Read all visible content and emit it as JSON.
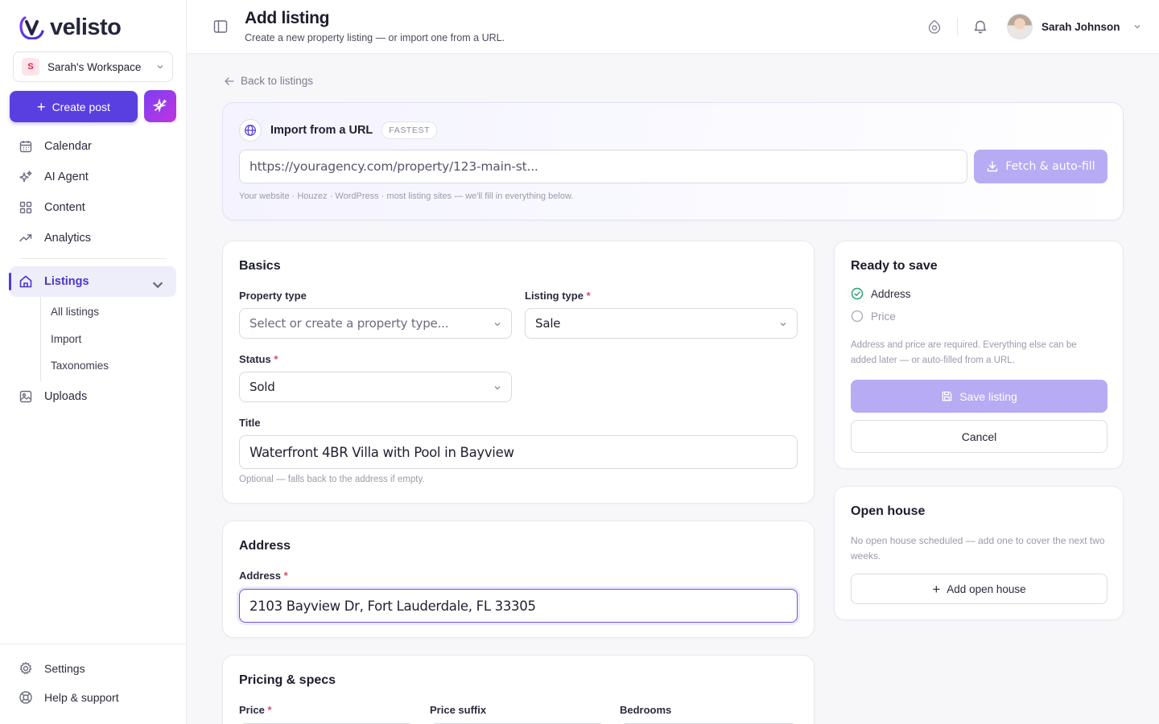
{
  "brand": {
    "name": "velisto"
  },
  "workspace": {
    "initial": "S",
    "name": "Sarah's Workspace"
  },
  "sidebar": {
    "create_post_label": "Create post",
    "items": [
      {
        "label": "Calendar",
        "icon": "calendar-icon"
      },
      {
        "label": "AI Agent",
        "icon": "sparkles-icon"
      },
      {
        "label": "Content",
        "icon": "grid-icon"
      },
      {
        "label": "Analytics",
        "icon": "trend-icon"
      }
    ],
    "listings": {
      "label": "Listings",
      "children": [
        "All listings",
        "Import",
        "Taxonomies"
      ]
    },
    "uploads_label": "Uploads",
    "settings_label": "Settings",
    "help_label": "Help & support"
  },
  "header": {
    "title": "Add listing",
    "subtitle": "Create a new property listing — or import one from a URL.",
    "user_name": "Sarah Johnson"
  },
  "back_link": "Back to listings",
  "import": {
    "title": "Import from a URL",
    "badge": "FASTEST",
    "url_placeholder": "https://youragency.com/property/123-main-st...",
    "fetch_label": "Fetch & auto-fill",
    "hint": "Your website · Houzez · WordPress · most listing sites — we'll fill in everything below."
  },
  "basics": {
    "title": "Basics",
    "property_type_label": "Property type",
    "property_type_placeholder": "Select or create a property type...",
    "listing_type_label": "Listing type",
    "listing_type_value": "Sale",
    "status_label": "Status",
    "status_value": "Sold",
    "title_label": "Title",
    "title_value": "Waterfront 4BR Villa with Pool in Bayview",
    "title_hint": "Optional — falls back to the address if empty.",
    "required_mark": "*"
  },
  "address": {
    "title": "Address",
    "label": "Address",
    "value": "2103 Bayview Dr, Fort Lauderdale, FL 33305"
  },
  "pricing": {
    "title": "Pricing & specs",
    "price_label": "Price",
    "price_suffix_label": "Price suffix",
    "bedrooms_label": "Bedrooms"
  },
  "ready": {
    "title": "Ready to save",
    "checks": [
      {
        "label": "Address",
        "done": true
      },
      {
        "label": "Price",
        "done": false
      }
    ],
    "note": "Address and price are required. Everything else can be added later — or auto-filled from a URL.",
    "save_label": "Save listing",
    "cancel_label": "Cancel"
  },
  "open_house": {
    "title": "Open house",
    "note": "No open house scheduled — add one to cover the next two weeks.",
    "add_label": "Add open house"
  },
  "colors": {
    "accent": "#5a3fe0",
    "accent_disabled": "#b7abf4",
    "success": "#22a06b"
  }
}
